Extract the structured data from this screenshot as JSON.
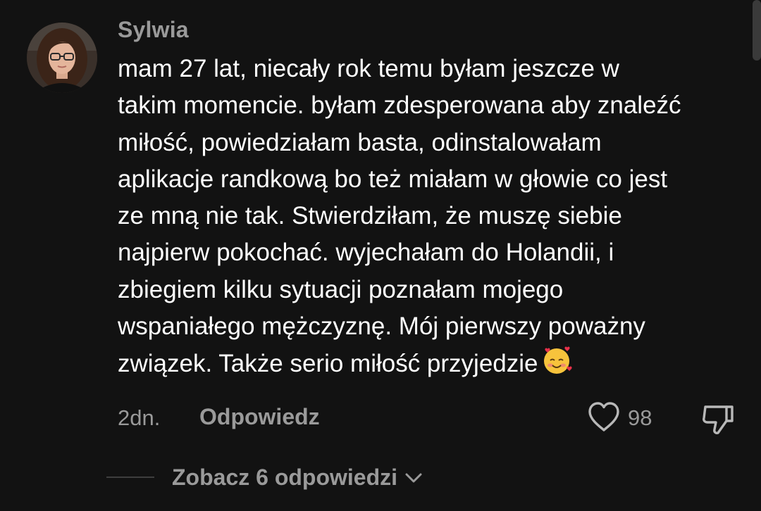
{
  "comment": {
    "username": "Sylwia",
    "text_lines": [
      "mam 27 lat, niecały rok temu byłam jeszcze w",
      "takim momencie. byłam zdesperowana aby znaleźć",
      "miłość, powiedziałam basta, odinstalowałam",
      "aplikacje randkową bo też miałam w głowie co jest",
      "ze mną nie tak. Stwierdziłam, że muszę siebie",
      "najpierw pokochać. wyjechałam do Holandii, i",
      "zbiegiem kilku sytuacji poznałam mojego",
      "wspaniałego mężczyznę. Mój pierwszy poważny",
      "związek. Także serio miłość przyjedzie"
    ],
    "emoji": "smiling-face-with-hearts-icon",
    "timestamp": "2dn.",
    "reply_label": "Odpowiedz",
    "like_count": "98"
  },
  "replies": {
    "view_label": "Zobacz 6 odpowiedzi"
  },
  "colors": {
    "background": "#121212",
    "text_primary": "#ffffff",
    "text_secondary": "#9a9a9a",
    "divider": "#3e3e3e"
  }
}
